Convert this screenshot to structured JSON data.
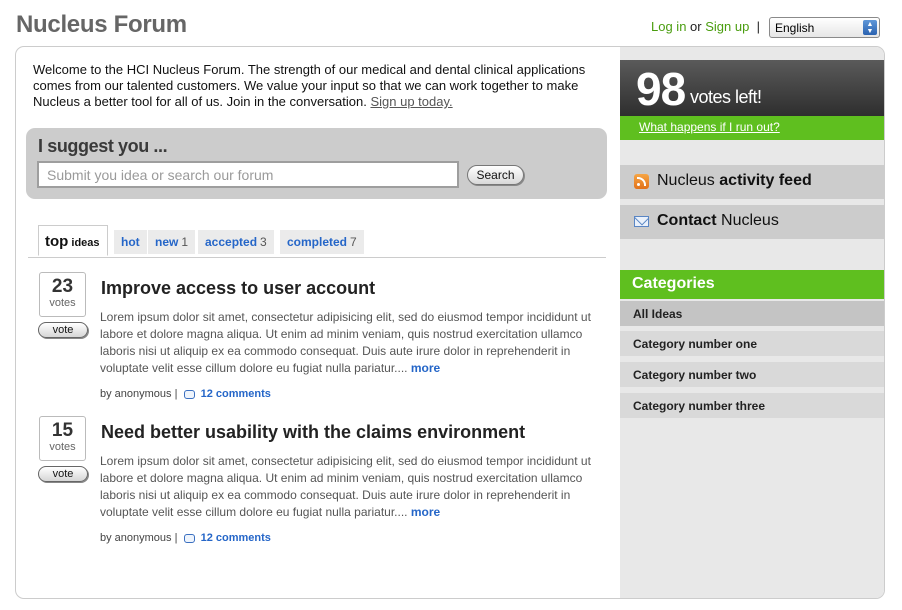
{
  "header": {
    "site_title": "Nucleus Forum",
    "login_label": "Log in",
    "or_text": "or",
    "signup_label": "Sign up",
    "separator": "|",
    "language": "English"
  },
  "welcome": {
    "text": "Welcome to the HCI Nucleus Forum. The strength of our medical and dental clinical applications comes from our talented customers. We value your input so that we can work together to make Nucleus a better tool for all of us. Join in the conversation.",
    "signup_link": "Sign up today."
  },
  "suggest": {
    "title": "I suggest you ...",
    "placeholder": "Submit you idea or search our forum",
    "search_button": "Search"
  },
  "tabs": [
    {
      "label": "top",
      "suffix": "ideas",
      "count": ""
    },
    {
      "label": "hot",
      "count": ""
    },
    {
      "label": "new",
      "count": "1"
    },
    {
      "label": "accepted",
      "count": "3"
    },
    {
      "label": "completed",
      "count": "7"
    }
  ],
  "ideas": [
    {
      "votes": "23",
      "votes_label": "votes",
      "vote_button": "vote",
      "title": "Improve access to user account",
      "body": "Lorem ipsum dolor sit amet, consectetur adipisicing elit, sed do eiusmod tempor incididunt ut labore et dolore magna aliqua. Ut enim ad minim veniam, quis nostrud exercitation ullamco laboris nisi ut aliquip ex ea commodo consequat. Duis aute irure dolor in reprehenderit in voluptate velit esse cillum dolore eu fugiat nulla pariatur....",
      "more": "more",
      "author": "by anonymous |",
      "comments": "12 comments"
    },
    {
      "votes": "15",
      "votes_label": "votes",
      "vote_button": "vote",
      "title": "Need better usability with the claims environment",
      "body": "Lorem ipsum dolor sit amet, consectetur adipisicing elit, sed do eiusmod tempor incididunt ut labore et dolore magna aliqua. Ut enim ad minim veniam, quis nostrud exercitation ullamco laboris nisi ut aliquip ex ea commodo consequat. Duis aute irure dolor in reprehenderit in voluptate velit esse cillum dolore eu fugiat nulla pariatur....",
      "more": "more",
      "author": "by anonymous |",
      "comments": "12 comments"
    }
  ],
  "sidebar": {
    "votes_left_number": "98",
    "votes_left_text": "votes left!",
    "what_happens_link": "What happens if I run out?",
    "activity_feed": {
      "prefix": "Nucleus",
      "bold": "activity feed",
      "icon": "rss-icon"
    },
    "contact": {
      "bold": "Contact",
      "suffix": "Nucleus",
      "icon": "mail-icon"
    },
    "categories_title": "Categories",
    "categories": [
      "All Ideas",
      "Category number one",
      "Category number two",
      "Category number three"
    ]
  },
  "colors": {
    "accent_green": "#5fbf1f",
    "link_blue": "#2566c8",
    "title_gray": "#666666"
  }
}
